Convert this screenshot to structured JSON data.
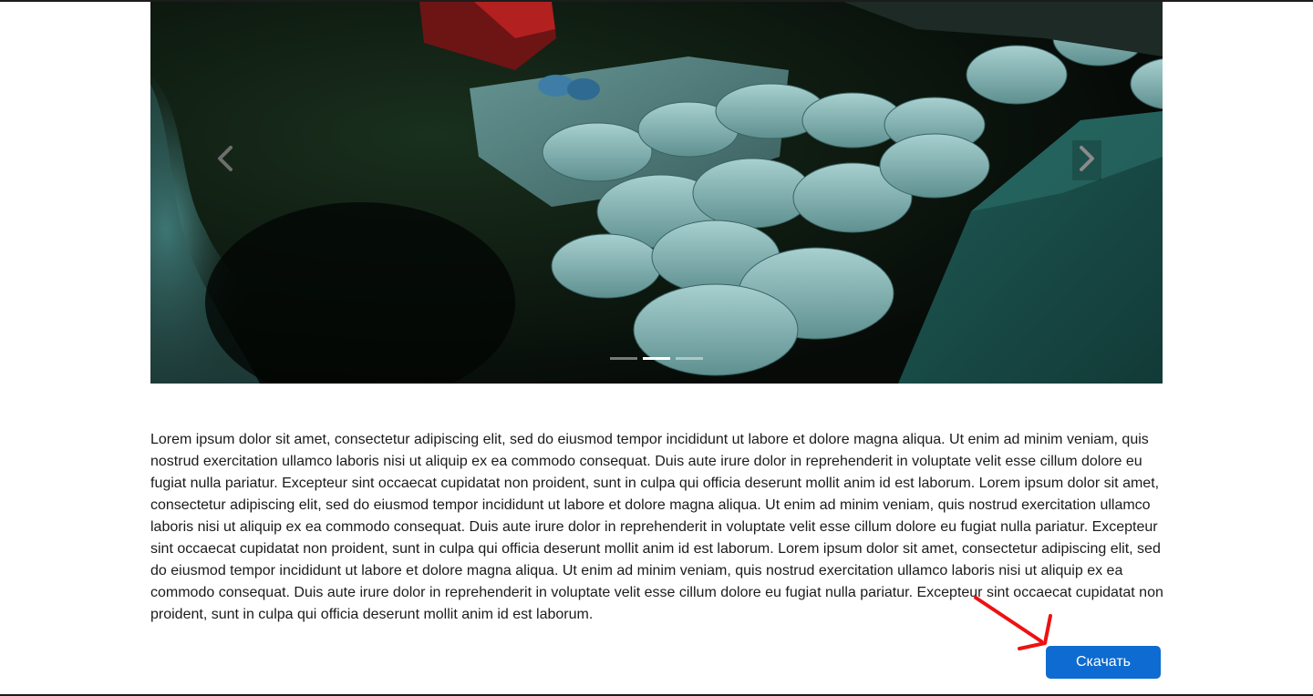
{
  "carousel": {
    "slide_count": 3,
    "active_index": 1,
    "prev_icon": "chevron-left-icon",
    "next_icon": "chevron-right-icon"
  },
  "content": {
    "description": "Lorem ipsum dolor sit amet, consectetur adipiscing elit, sed do eiusmod tempor incididunt ut labore et dolore magna aliqua. Ut enim ad minim veniam, quis nostrud exercitation ullamco laboris nisi ut aliquip ex ea commodo consequat. Duis aute irure dolor in reprehenderit in voluptate velit esse cillum dolore eu fugiat nulla pariatur. Excepteur sint occaecat cupidatat non proident, sunt in culpa qui officia deserunt mollit anim id est laborum. Lorem ipsum dolor sit amet, consectetur adipiscing elit, sed do eiusmod tempor incididunt ut labore et dolore magna aliqua. Ut enim ad minim veniam, quis nostrud exercitation ullamco laboris nisi ut aliquip ex ea commodo consequat. Duis aute irure dolor in reprehenderit in voluptate velit esse cillum dolore eu fugiat nulla pariatur. Excepteur sint occaecat cupidatat non proident, sunt in culpa qui officia deserunt mollit anim id est laborum. Lorem ipsum dolor sit amet, consectetur adipiscing elit, sed do eiusmod tempor incididunt ut labore et dolore magna aliqua. Ut enim ad minim veniam, quis nostrud exercitation ullamco laboris nisi ut aliquip ex ea commodo consequat. Duis aute irure dolor in reprehenderit in voluptate velit esse cillum dolore eu fugiat nulla pariatur. Excepteur sint occaecat cupidatat non proident, sunt in culpa qui officia deserunt mollit anim id est laborum."
  },
  "actions": {
    "download_label": "Скачать"
  },
  "colors": {
    "button": "#0d6bd1",
    "annotation_arrow": "#ee1111",
    "text": "#1b1b1b"
  }
}
